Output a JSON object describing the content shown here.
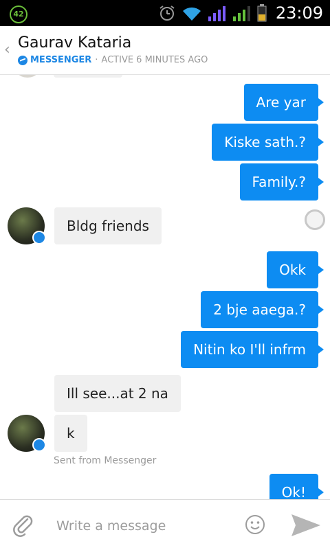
{
  "status": {
    "battery_badge": "42",
    "time": "23:09"
  },
  "header": {
    "back_glyph": "‹",
    "name": "Gaurav Kataria",
    "app": "MESSENGER",
    "separator": "·",
    "active": "ACTIVE 6 MINUTES AGO"
  },
  "messages": [
    {
      "text": "Are yar"
    },
    {
      "text": "Kiske sath.?"
    },
    {
      "text": "Family.?"
    },
    {
      "text": "Bldg friends"
    },
    {
      "text": "Okk"
    },
    {
      "text": "2 bje aaega.?"
    },
    {
      "text": "Nitin ko I'll infrm"
    },
    {
      "text": "Ill see...at 2 na"
    },
    {
      "text": "k"
    },
    {
      "text": "Ok!"
    }
  ],
  "sent_from": "Sent from Messenger",
  "composer": {
    "placeholder": "Write a message"
  },
  "icons": [
    "battery-badge-icon",
    "alarm-icon",
    "wifi-icon",
    "signal-icon",
    "battery-icon",
    "back-chevron-icon",
    "messenger-icon",
    "paperclip-icon",
    "emoji-icon",
    "send-icon",
    "seen-indicator-icon"
  ],
  "colors": {
    "outgoing": "#0d8cf2",
    "incoming": "#f0f0f0",
    "accent": "#1d87e4"
  }
}
